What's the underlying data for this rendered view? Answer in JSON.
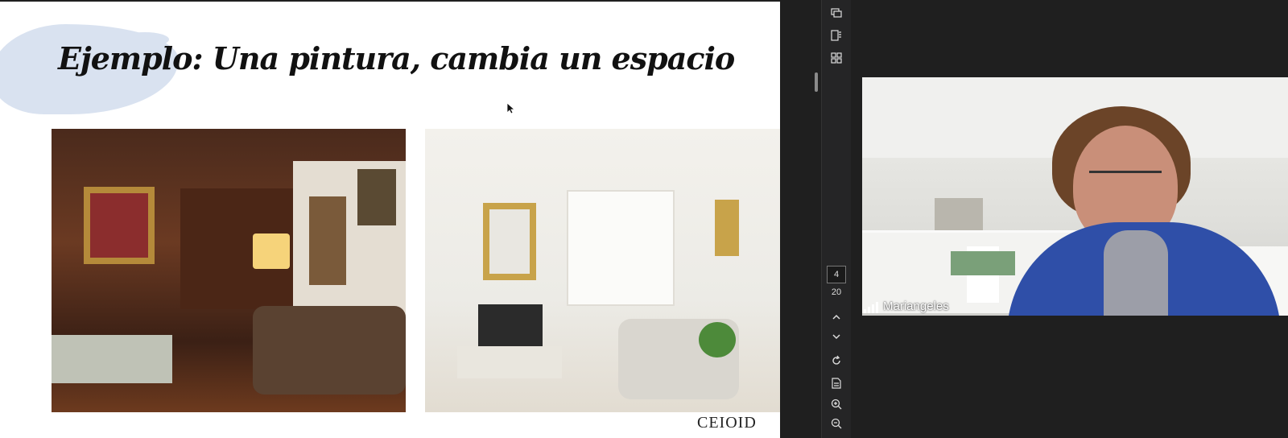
{
  "slide": {
    "title": "Ejemplo: Una pintura, cambia un espacio",
    "logo": "CEIOID",
    "images": [
      {
        "alt": "traditional living room"
      },
      {
        "alt": "bright white living room"
      }
    ]
  },
  "toolbar": {
    "icons": [
      "chat-icon",
      "bookmark-icon",
      "grid-icon",
      "chevron-up-icon",
      "chevron-down-icon",
      "refresh-icon",
      "document-icon",
      "zoom-in-icon",
      "zoom-out-icon"
    ],
    "current_page": "4",
    "total_pages": "20"
  },
  "video": {
    "participant_name": "Mariangeles"
  },
  "colors": {
    "background": "#1f1f1f",
    "slide_bg": "#ffffff",
    "brush": "#d9e2f0",
    "jacket": "#2f4fa8"
  }
}
